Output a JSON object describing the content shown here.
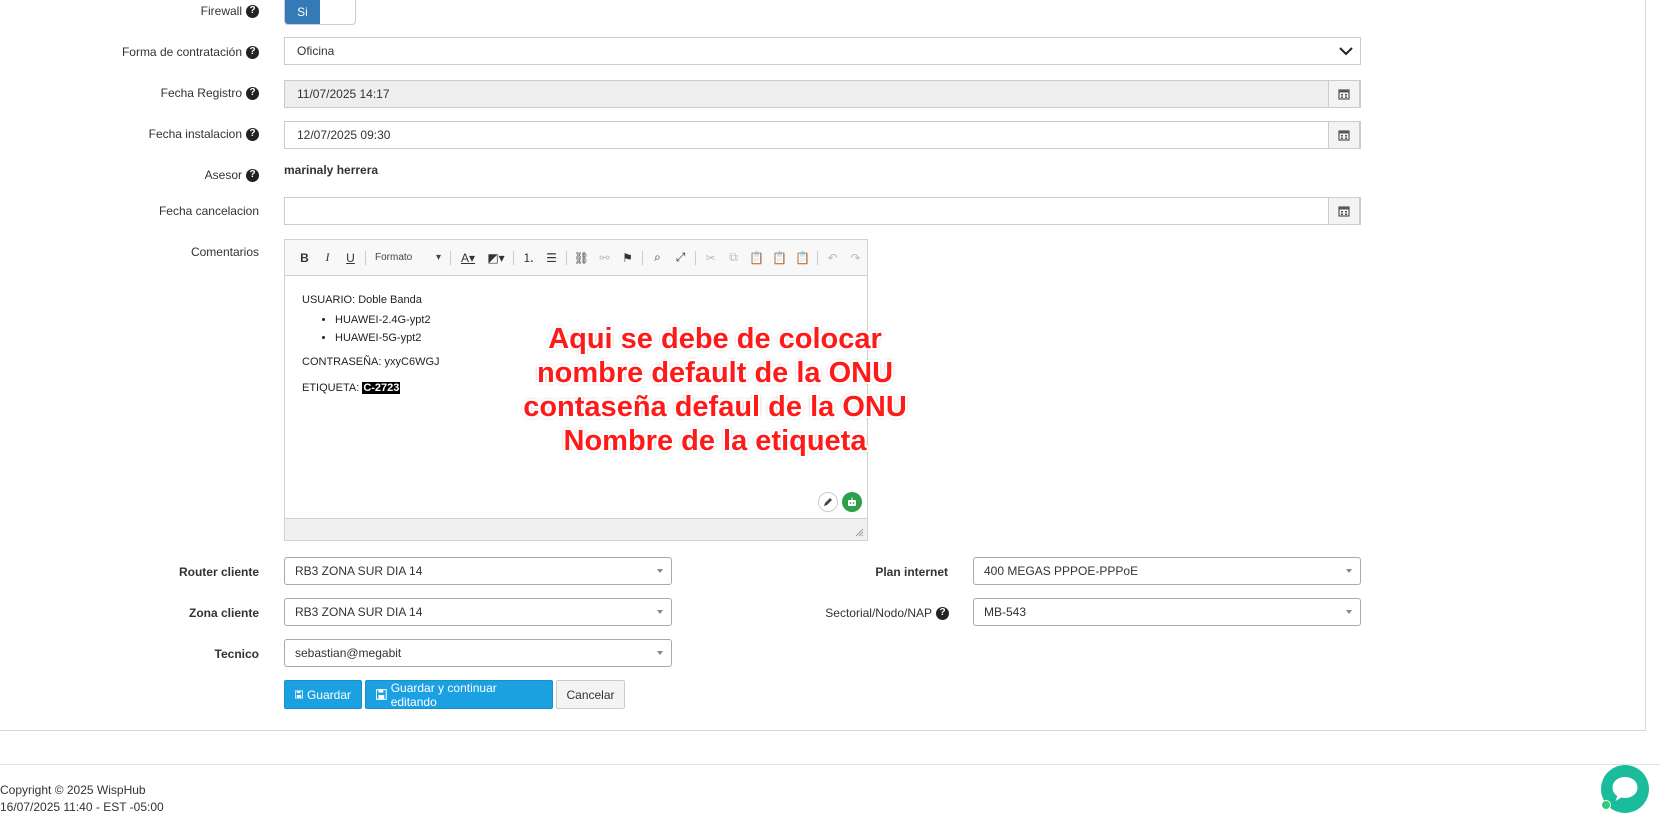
{
  "form": {
    "firewall": {
      "label": "Firewall",
      "value": "Si"
    },
    "contract_type": {
      "label": "Forma de contratación",
      "value": "Oficina"
    },
    "register_date": {
      "label": "Fecha Registro",
      "value": "11/07/2025 14:17"
    },
    "install_date": {
      "label": "Fecha instalacion",
      "value": "12/07/2025 09:30"
    },
    "advisor": {
      "label": "Asesor",
      "value": "marinaly herrera"
    },
    "cancel_date": {
      "label": "Fecha cancelacion",
      "value": ""
    },
    "comments": {
      "label": "Comentarios",
      "toolbar_format": "Formato",
      "usuario_line": "USUARIO: Doble Banda",
      "bullets": [
        "HUAWEI-2.4G-ypt2",
        "HUAWEI-5G-ypt2"
      ],
      "password_line": "CONTRASEÑA: yxyC6WGJ",
      "tag_label": "ETIQUETA: ",
      "tag_value": "C-2723"
    },
    "router": {
      "label": "Router cliente",
      "value": "RB3 ZONA SUR DIA 14"
    },
    "zone": {
      "label": "Zona cliente",
      "value": "RB3 ZONA SUR DIA 14"
    },
    "technician": {
      "label": "Tecnico",
      "value": "sebastian@megabit"
    },
    "plan": {
      "label": "Plan internet",
      "value": "400 MEGAS PPPOE-PPPoE"
    },
    "sector": {
      "label": "Sectorial/Nodo/NAP",
      "value": "MB-543"
    }
  },
  "buttons": {
    "save": "Guardar",
    "save_continue": "Guardar y continuar editando",
    "cancel": "Cancelar"
  },
  "annotation": {
    "line1": "Aqui se debe de colocar",
    "line2": "nombre default de la ONU",
    "line3": "contaseña defaul de la ONU",
    "line4": "Nombre de la etiqueta"
  },
  "footer": {
    "copyright": "Copyright © 2025 WispHub",
    "datetime": "16/07/2025 11:40 - EST -05:00"
  },
  "colors": {
    "primary": "#1ba1e2",
    "toggle": "#337ab7",
    "annotation": "#ff1a1a",
    "chat": "#1abc9c"
  }
}
